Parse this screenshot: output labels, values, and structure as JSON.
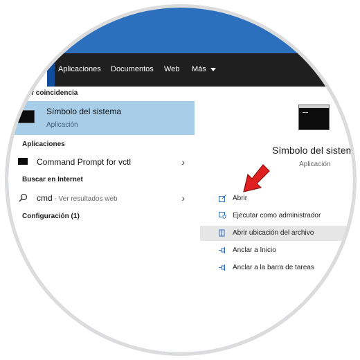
{
  "tabs": [
    {
      "label": "Aplicaciones"
    },
    {
      "label": "Documentos"
    },
    {
      "label": "Web"
    },
    {
      "label": "Más"
    }
  ],
  "left": {
    "best_match_header": "or coincidencia",
    "best_match": {
      "title": "Símbolo del sistema",
      "subtitle": "Aplicación"
    },
    "apps_header": "Aplicaciones",
    "apps_item": "Command Prompt for vctl",
    "web_header": "Buscar en Internet",
    "web_query": "cmd",
    "web_suffix": " - Ver resultados web",
    "settings_header": "Configuración (1)"
  },
  "right": {
    "title": "Símbolo del sistema",
    "subtitle": "Aplicación",
    "actions": [
      {
        "label": "Abrir",
        "icon": "open-icon"
      },
      {
        "label": "Ejecutar como administrador",
        "icon": "shield-icon"
      },
      {
        "label": "Abrir ubicación del archivo",
        "icon": "folder-icon"
      },
      {
        "label": "Anclar a Inicio",
        "icon": "pin-icon"
      },
      {
        "label": "Anclar a la barra de tareas",
        "icon": "pin-icon"
      }
    ]
  },
  "colors": {
    "accent": "#2c6fbd",
    "selection": "#a8cde8",
    "pointer_arrow": "#e02020"
  }
}
